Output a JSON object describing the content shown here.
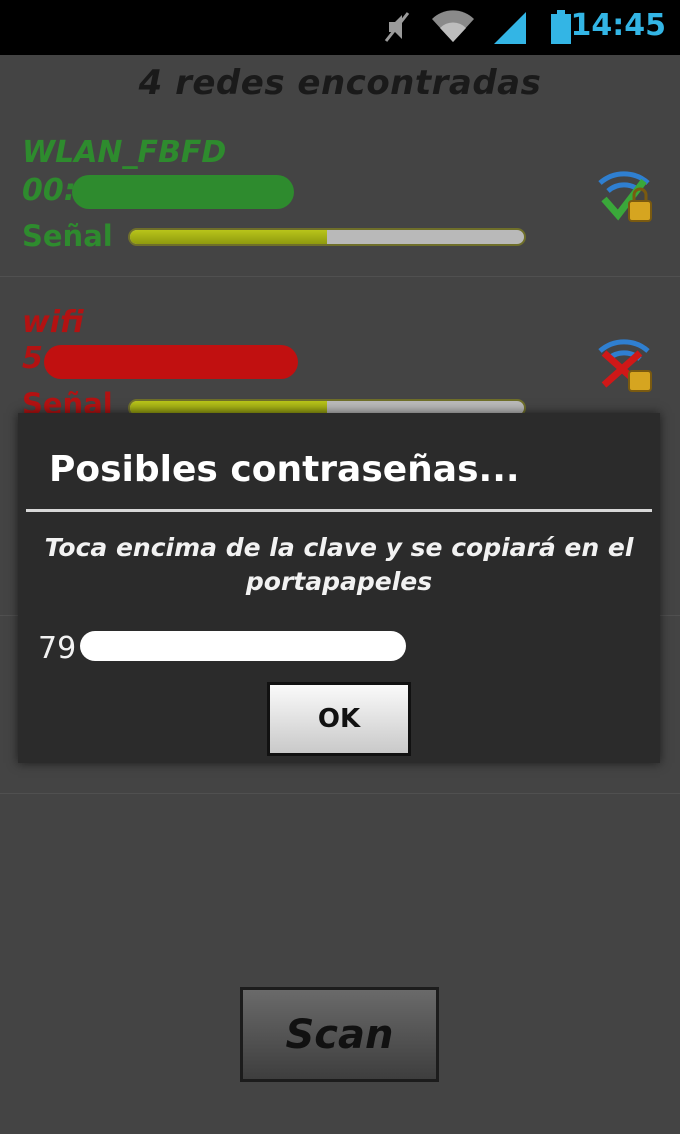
{
  "status_bar": {
    "time": "14:45",
    "icons": [
      "mute-icon",
      "wifi-icon",
      "cell-signal-icon",
      "battery-icon"
    ],
    "accent": "#33b5e5"
  },
  "header": {
    "title": "4 redes encontradas"
  },
  "networks": [
    {
      "ssid": "WLAN_FBFD",
      "mac_prefix": "00:",
      "signal_label": "Señal",
      "signal_level": 0.5,
      "status_icon": "wifi-lock-ok-icon",
      "color": "#2e8b2e"
    },
    {
      "ssid": "wifi",
      "mac_prefix": "5",
      "signal_label": "Señal",
      "signal_level": 0.5,
      "status_icon": "wifi-lock-fail-icon",
      "color": "#b31212"
    }
  ],
  "dialog": {
    "title": "Posibles contraseñas...",
    "message": "Toca encima de la clave y se copiará en el portapapeles",
    "password_prefix": "79",
    "ok_label": "OK"
  },
  "scan_button": {
    "label": "Scan"
  }
}
